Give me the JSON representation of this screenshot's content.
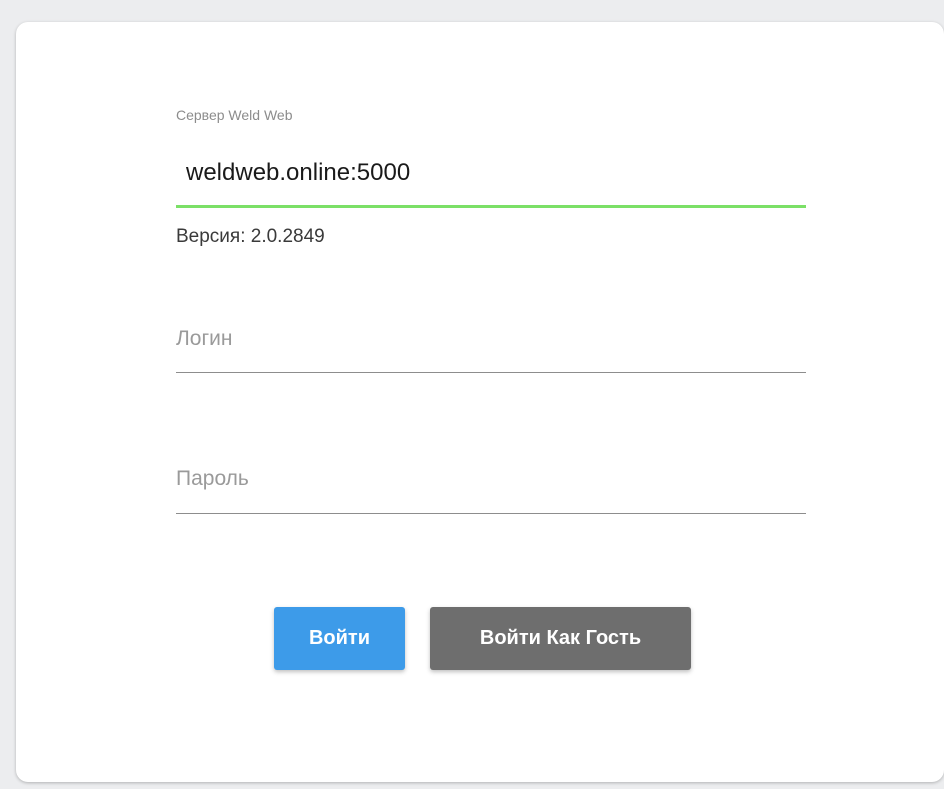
{
  "server": {
    "label": "Сервер Weld Web",
    "value": "weldweb.online:5000",
    "accent_color": "#7be067"
  },
  "version": {
    "text": "Версия: 2.0.2849"
  },
  "login": {
    "placeholder": "Логин"
  },
  "password": {
    "placeholder": "Пароль"
  },
  "buttons": {
    "login_label": "Войти",
    "login_color": "#3d9be9",
    "guest_label": "Войти Как Гость",
    "guest_color": "#6e6e6e"
  }
}
